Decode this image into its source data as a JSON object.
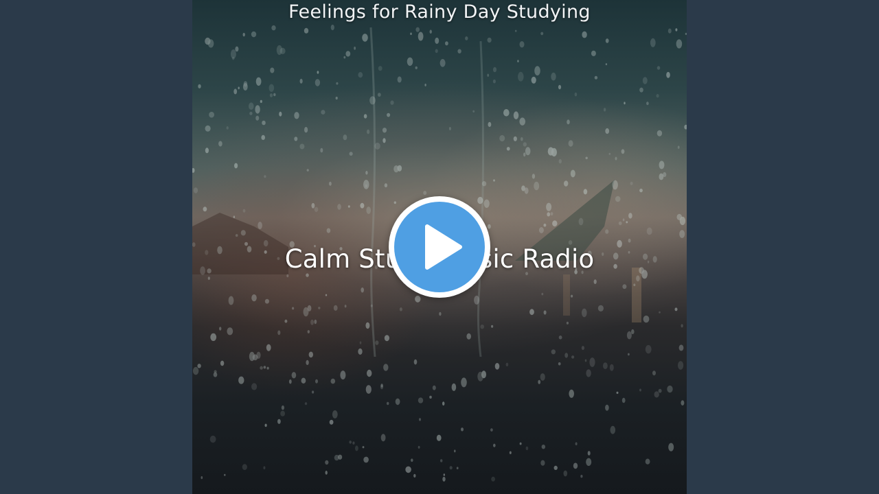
{
  "video": {
    "title": "Feelings for Rainy Day Studying",
    "subtitle": "Calm Study Music Radio"
  },
  "player": {
    "play_icon": "play-icon",
    "accent_color": "#4f9fe3"
  },
  "colors": {
    "background": "#2b3a4a"
  }
}
